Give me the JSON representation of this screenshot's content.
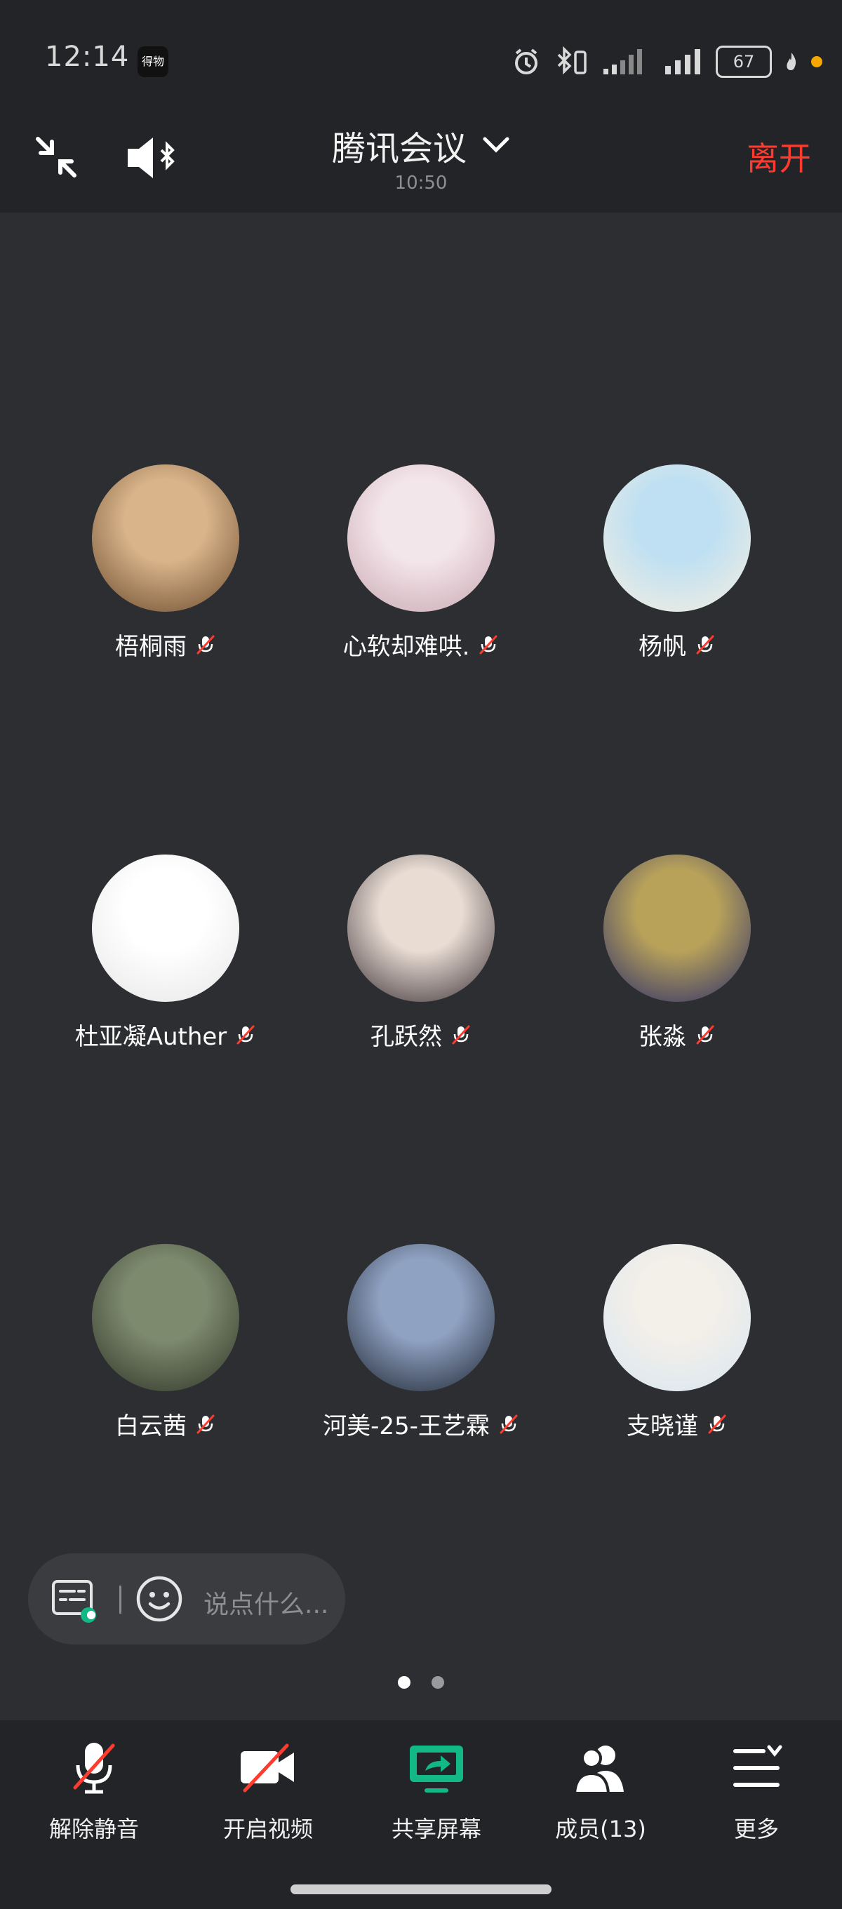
{
  "status_bar": {
    "time": "12:14",
    "app_chip": "得物",
    "battery": "67"
  },
  "header": {
    "title": "腾讯会议",
    "duration": "10:50",
    "leave_label": "离开"
  },
  "participants": [
    {
      "name": "梧桐雨"
    },
    {
      "name": "心软却难哄."
    },
    {
      "name": "杨帆"
    },
    {
      "name": "杜亚凝Auther"
    },
    {
      "name": "孔跃然"
    },
    {
      "name": "张淼"
    },
    {
      "name": "白云茜"
    },
    {
      "name": "河美-25-王艺霖"
    },
    {
      "name": "支晓谨"
    }
  ],
  "chat": {
    "placeholder": "说点什么..."
  },
  "toolbar": {
    "unmute_label": "解除静音",
    "video_label": "开启视频",
    "share_label": "共享屏幕",
    "members_label": "成员(13)",
    "more_label": "更多"
  },
  "colors": {
    "accent_green": "#12b886",
    "leave_red": "#ff3b30"
  }
}
